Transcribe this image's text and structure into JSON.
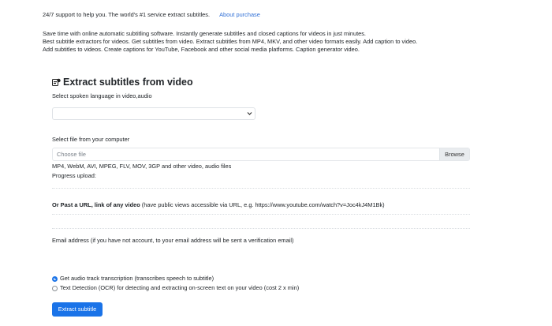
{
  "intro": {
    "support_text": "24/7 support to help you. The world's #1 service extract subtitles.",
    "about_link": "About purchase"
  },
  "description": {
    "line1": "Save time with online automatic subtitling software. Instantly generate subtitles and closed captions for videos in just minutes.",
    "line2": "Best subtitle extractors for videos. Get subtitles from video. Extract subtitles from MP4, MKV, and other video formats easily. Add caption to video.",
    "line3": "Add subtitles to videos. Create captions for YouTube, Facebook and other social media platforms. Caption generator video."
  },
  "form": {
    "title": "Extract subtitles from video",
    "title_icon": "subtitle-cc-icon",
    "language_label": "Select spoken language in video,audio",
    "language_value": "",
    "file_label": "Select file from your computer",
    "file_placeholder": "Choose file",
    "browse_label": "Browse",
    "formats_text": "MP4, WebM, AVI, MPEG, FLV, MOV, 3GP and other video, audio files",
    "progress_label": "Progress upload:",
    "url_label_bold": "Or Past a URL, link of any video",
    "url_label_rest": " (have public views accessible via URL, e.g. https://www.youtube.com/watch?v=Joc4kJ4M1Bk)",
    "email_label": "Email address (if you have not account, to your email address will be sent a verification email)",
    "option_transcription": "Get audio track transcription (transcribes speech to subtitle)",
    "option_ocr": "Text Detection (OCR) for detecting and extracting on-screen text on your video (cost 2 x min)",
    "selected_option": "transcription",
    "submit_label": "Extract subtitle"
  },
  "colors": {
    "accent": "#1a73e8",
    "link": "#2f6fd6",
    "text": "#212529"
  }
}
